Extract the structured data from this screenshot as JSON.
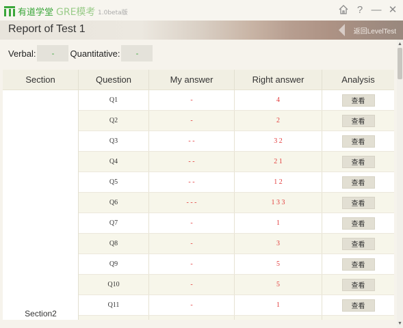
{
  "app": {
    "logo_text": "有道学堂",
    "title": "GRE模考",
    "version": "1.0beta版"
  },
  "window": {
    "home_icon": "home-icon",
    "help_label": "?",
    "minimize_label": "—",
    "close_label": "✕"
  },
  "header": {
    "title": "Report of Test 1",
    "back_label": "返回LevelTest"
  },
  "scores": {
    "verbal_label": "Verbal:",
    "verbal_value": "-",
    "quant_label": "Quantitative:",
    "quant_value": "-"
  },
  "table": {
    "headers": [
      "Section",
      "Question",
      "My answer",
      "Right answer",
      "Analysis"
    ],
    "section": "Section2",
    "view_label": "查看",
    "rows": [
      {
        "q": "Q1",
        "mine": "-",
        "right": "4"
      },
      {
        "q": "Q2",
        "mine": "-",
        "right": "2"
      },
      {
        "q": "Q3",
        "mine": "- -",
        "right": "3 2"
      },
      {
        "q": "Q4",
        "mine": "- -",
        "right": "2 1"
      },
      {
        "q": "Q5",
        "mine": "- -",
        "right": "1 2"
      },
      {
        "q": "Q6",
        "mine": "- - -",
        "right": "1 3 3"
      },
      {
        "q": "Q7",
        "mine": "-",
        "right": "1"
      },
      {
        "q": "Q8",
        "mine": "-",
        "right": "3"
      },
      {
        "q": "Q9",
        "mine": "-",
        "right": "5"
      },
      {
        "q": "Q10",
        "mine": "-",
        "right": "5"
      },
      {
        "q": "Q11",
        "mine": "-",
        "right": "1"
      },
      {
        "q": "",
        "mine": "",
        "right": ""
      }
    ]
  },
  "colors": {
    "brand_green": "#3aa63a",
    "answer_red": "#e23a3a"
  }
}
